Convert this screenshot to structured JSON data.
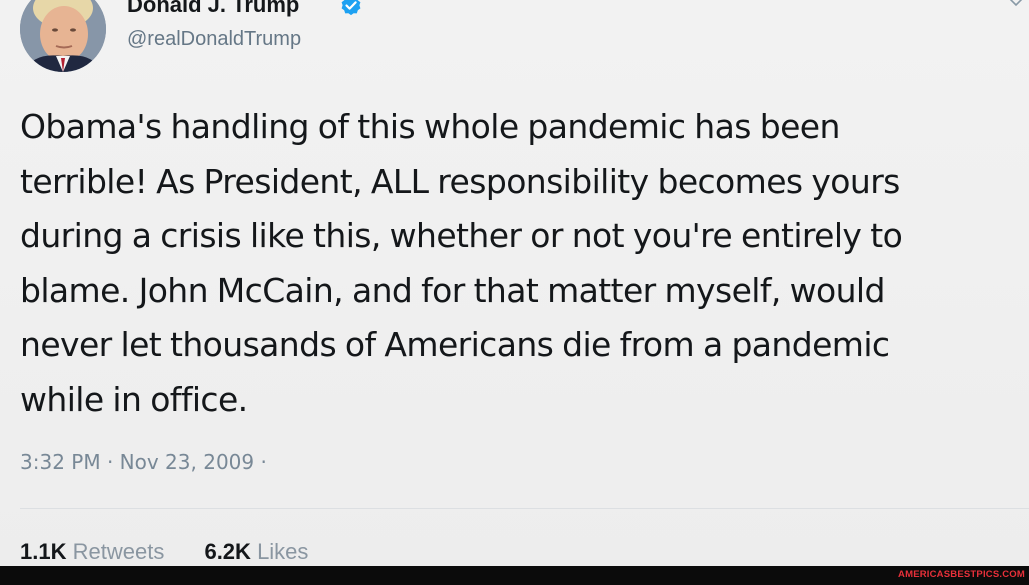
{
  "author": {
    "name": "Donald J. Trump",
    "handle": "@realDonaldTrump",
    "verified": true,
    "avatar": "profile-photo"
  },
  "tweet": {
    "lines": [
      "Obama's handling of this whole pandemic has been",
      "terrible! As President, ALL responsibility becomes yours",
      "during a crisis like this, whether or not you're entirely to",
      "blame. John McCain, and for that matter myself, would",
      "never let thousands of Americans die from a pandemic",
      "while in office."
    ],
    "timestamp": "3:32 PM · Nov 23, 2009 ·"
  },
  "stats": {
    "retweets_count": "1.1K",
    "retweets_label": "Retweets",
    "likes_count": "6.2K",
    "likes_label": "Likes"
  },
  "watermark": "AMERICASBESTPICS.COM",
  "icons": {
    "verified": "verified-badge-icon",
    "menu": "chevron-down-icon"
  },
  "colors": {
    "background": "#f0f0f0",
    "text": "#14171a",
    "muted": "#657786",
    "verified": "#1da1f2",
    "watermark": "#e8303a"
  }
}
